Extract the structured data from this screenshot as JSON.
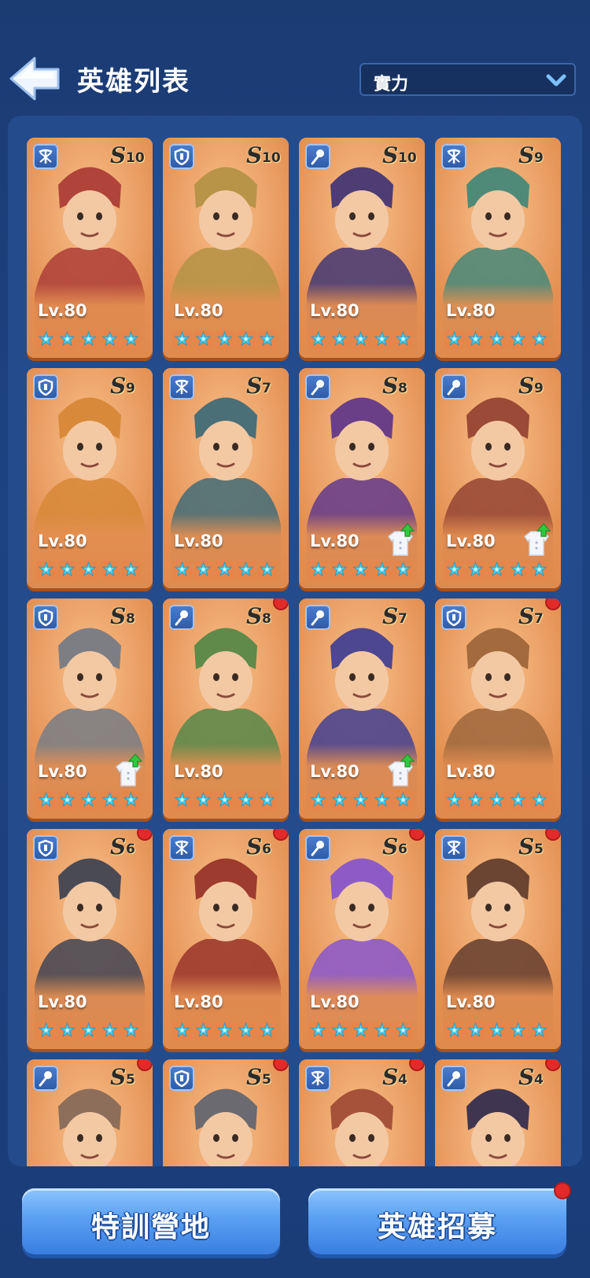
{
  "header": {
    "title": "英雄列表",
    "sort_label": "實力"
  },
  "buttons": {
    "training": "特訓營地",
    "recruit": "英雄招募"
  },
  "colors": {
    "card_bg": "#e48f52",
    "badge_blue": "#2d5aa6",
    "star_cyan": "#4fd0ef",
    "notification_red": "#e32a2a"
  },
  "heroes": [
    {
      "role": "crossbow-icon",
      "tier": "S",
      "tier_num": "10",
      "level": "Lv.80",
      "stars": 5,
      "upgrade": false,
      "dot": false,
      "tone": "#b0443a"
    },
    {
      "role": "shield-icon",
      "tier": "S",
      "tier_num": "10",
      "level": "Lv.80",
      "stars": 5,
      "upgrade": false,
      "dot": false,
      "tone": "#b79447"
    },
    {
      "role": "staff-icon",
      "tier": "S",
      "tier_num": "10",
      "level": "Lv.80",
      "stars": 5,
      "upgrade": false,
      "dot": false,
      "tone": "#4d3d74"
    },
    {
      "role": "crossbow-icon",
      "tier": "S",
      "tier_num": "9",
      "level": "Lv.80",
      "stars": 5,
      "upgrade": false,
      "dot": false,
      "tone": "#4f8a78"
    },
    {
      "role": "shield-icon",
      "tier": "S",
      "tier_num": "9",
      "level": "Lv.80",
      "stars": 5,
      "upgrade": false,
      "dot": false,
      "tone": "#d88a3a"
    },
    {
      "role": "crossbow-icon",
      "tier": "S",
      "tier_num": "7",
      "level": "Lv.80",
      "stars": 5,
      "upgrade": false,
      "dot": false,
      "tone": "#4b6f77"
    },
    {
      "role": "staff-icon",
      "tier": "S",
      "tier_num": "8",
      "level": "Lv.80",
      "stars": 5,
      "upgrade": true,
      "dot": false,
      "tone": "#6a3f88"
    },
    {
      "role": "staff-icon",
      "tier": "S",
      "tier_num": "9",
      "level": "Lv.80",
      "stars": 5,
      "upgrade": true,
      "dot": false,
      "tone": "#9a4a36"
    },
    {
      "role": "shield-icon",
      "tier": "S",
      "tier_num": "8",
      "level": "Lv.80",
      "stars": 5,
      "upgrade": true,
      "dot": false,
      "tone": "#7d7e84"
    },
    {
      "role": "staff-icon",
      "tier": "S",
      "tier_num": "8",
      "level": "Lv.80",
      "stars": 5,
      "upgrade": false,
      "dot": true,
      "tone": "#5f8a4a"
    },
    {
      "role": "staff-icon",
      "tier": "S",
      "tier_num": "7",
      "level": "Lv.80",
      "stars": 5,
      "upgrade": true,
      "dot": false,
      "tone": "#4d4690"
    },
    {
      "role": "shield-icon",
      "tier": "S",
      "tier_num": "7",
      "level": "Lv.80",
      "stars": 5,
      "upgrade": false,
      "dot": true,
      "tone": "#a36a3e"
    },
    {
      "role": "shield-icon",
      "tier": "S",
      "tier_num": "6",
      "level": "Lv.80",
      "stars": 5,
      "upgrade": false,
      "dot": true,
      "tone": "#4a4a55"
    },
    {
      "role": "crossbow-icon",
      "tier": "S",
      "tier_num": "6",
      "level": "Lv.80",
      "stars": 5,
      "upgrade": false,
      "dot": true,
      "tone": "#9c3b2e"
    },
    {
      "role": "staff-icon",
      "tier": "S",
      "tier_num": "6",
      "level": "Lv.80",
      "stars": 5,
      "upgrade": false,
      "dot": true,
      "tone": "#8e5bc6"
    },
    {
      "role": "crossbow-icon",
      "tier": "S",
      "tier_num": "5",
      "level": "Lv.80",
      "stars": 5,
      "upgrade": false,
      "dot": true,
      "tone": "#6b4432"
    },
    {
      "role": "staff-icon",
      "tier": "S",
      "tier_num": "5",
      "level": "",
      "stars": 0,
      "upgrade": false,
      "dot": true,
      "tone": "#8d6e5a"
    },
    {
      "role": "shield-icon",
      "tier": "S",
      "tier_num": "5",
      "level": "",
      "stars": 0,
      "upgrade": false,
      "dot": true,
      "tone": "#6a6a70"
    },
    {
      "role": "crossbow-icon",
      "tier": "S",
      "tier_num": "4",
      "level": "",
      "stars": 0,
      "upgrade": false,
      "dot": true,
      "tone": "#a6523a"
    },
    {
      "role": "staff-icon",
      "tier": "S",
      "tier_num": "4",
      "level": "",
      "stars": 0,
      "upgrade": false,
      "dot": true,
      "tone": "#3f3550"
    }
  ]
}
